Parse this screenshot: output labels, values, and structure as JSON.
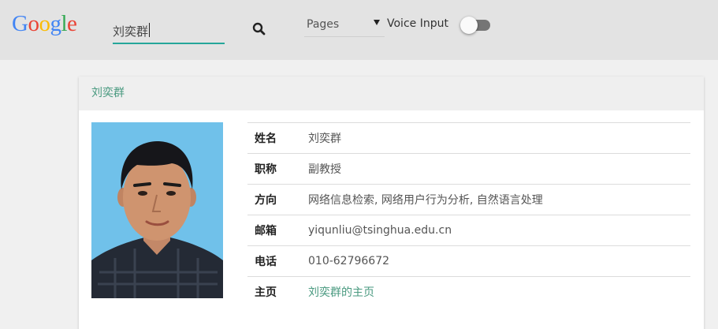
{
  "header": {
    "logo_letters": [
      {
        "ch": "G",
        "color": "#4285f4"
      },
      {
        "ch": "o",
        "color": "#ea4335"
      },
      {
        "ch": "o",
        "color": "#fbbc05"
      },
      {
        "ch": "g",
        "color": "#4285f4"
      },
      {
        "ch": "l",
        "color": "#34a853"
      },
      {
        "ch": "e",
        "color": "#ea4335"
      }
    ],
    "search_value": "刘奕群",
    "search_icon": "search-icon",
    "select_value": "Pages",
    "voice_label": "Voice Input",
    "voice_enabled": false,
    "accent_color": "#26a69a"
  },
  "card": {
    "title": "刘奕群",
    "photo": "portrait-photo",
    "rows": [
      {
        "key": "姓名",
        "value": "刘奕群"
      },
      {
        "key": "职称",
        "value": "副教授"
      },
      {
        "key": "方向",
        "value": "网络信息检索, 网络用户行为分析, 自然语言处理"
      },
      {
        "key": "邮箱",
        "value": "yiqunliu@tsinghua.edu.cn"
      },
      {
        "key": "电话",
        "value": "010-62796672"
      },
      {
        "key": "主页",
        "value": "刘奕群的主页"
      }
    ]
  }
}
